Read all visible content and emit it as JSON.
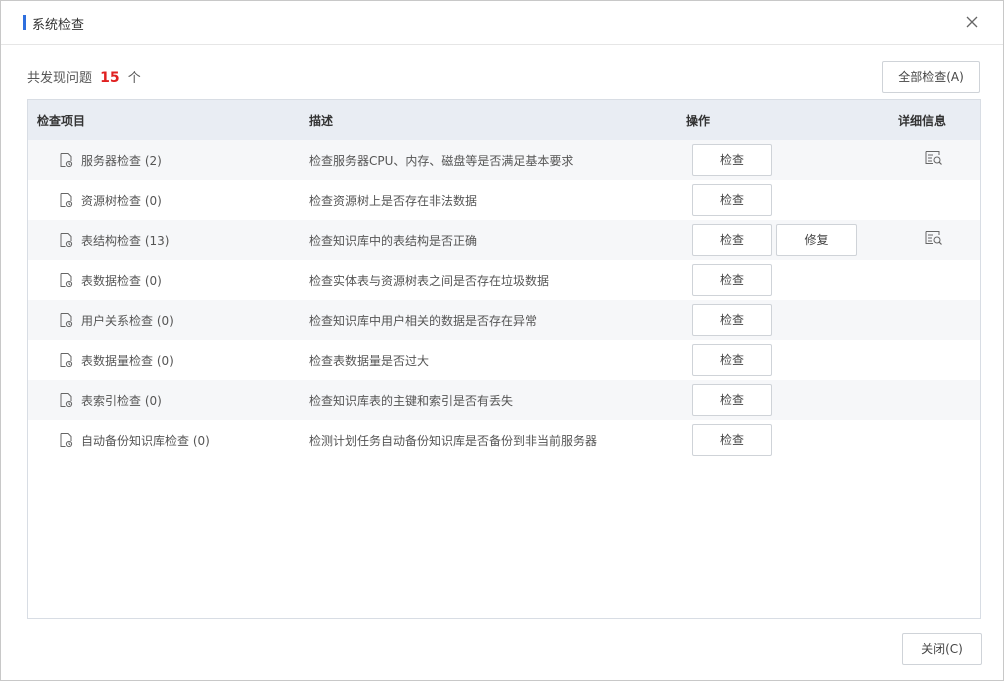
{
  "dialog": {
    "title": "系统检查",
    "close_icon": "close-icon"
  },
  "summary": {
    "prefix": "共发现问题",
    "count": "15",
    "suffix": "个"
  },
  "buttons": {
    "check_all": "全部检查(A)",
    "close": "关闭(C)"
  },
  "table": {
    "headers": {
      "item": "检查项目",
      "desc": "描述",
      "action": "操作",
      "detail": "详细信息"
    },
    "rows": [
      {
        "name": "服务器检查 (2)",
        "desc": "检查服务器CPU、内存、磁盘等是否满足基本要求",
        "check": "检查",
        "fix": "",
        "has_detail": true
      },
      {
        "name": "资源树检查 (0)",
        "desc": "检查资源树上是否存在非法数据",
        "check": "检查",
        "fix": "",
        "has_detail": false
      },
      {
        "name": "表结构检查 (13)",
        "desc": "检查知识库中的表结构是否正确",
        "check": "检查",
        "fix": "修复",
        "has_detail": true
      },
      {
        "name": "表数据检查 (0)",
        "desc": "检查实体表与资源树表之间是否存在垃圾数据",
        "check": "检查",
        "fix": "",
        "has_detail": false
      },
      {
        "name": "用户关系检查 (0)",
        "desc": "检查知识库中用户相关的数据是否存在异常",
        "check": "检查",
        "fix": "",
        "has_detail": false
      },
      {
        "name": "表数据量检查 (0)",
        "desc": "检查表数据量是否过大",
        "check": "检查",
        "fix": "",
        "has_detail": false
      },
      {
        "name": "表索引检查 (0)",
        "desc": "检查知识库表的主键和索引是否有丢失",
        "check": "检查",
        "fix": "",
        "has_detail": false
      },
      {
        "name": "自动备份知识库检查 (0)",
        "desc": "检测计划任务自动备份知识库是否备份到非当前服务器",
        "check": "检查",
        "fix": "",
        "has_detail": false
      }
    ]
  },
  "colors": {
    "accent": "#2f6fde",
    "count": "#e02020",
    "header_bg": "#e9edf3"
  }
}
